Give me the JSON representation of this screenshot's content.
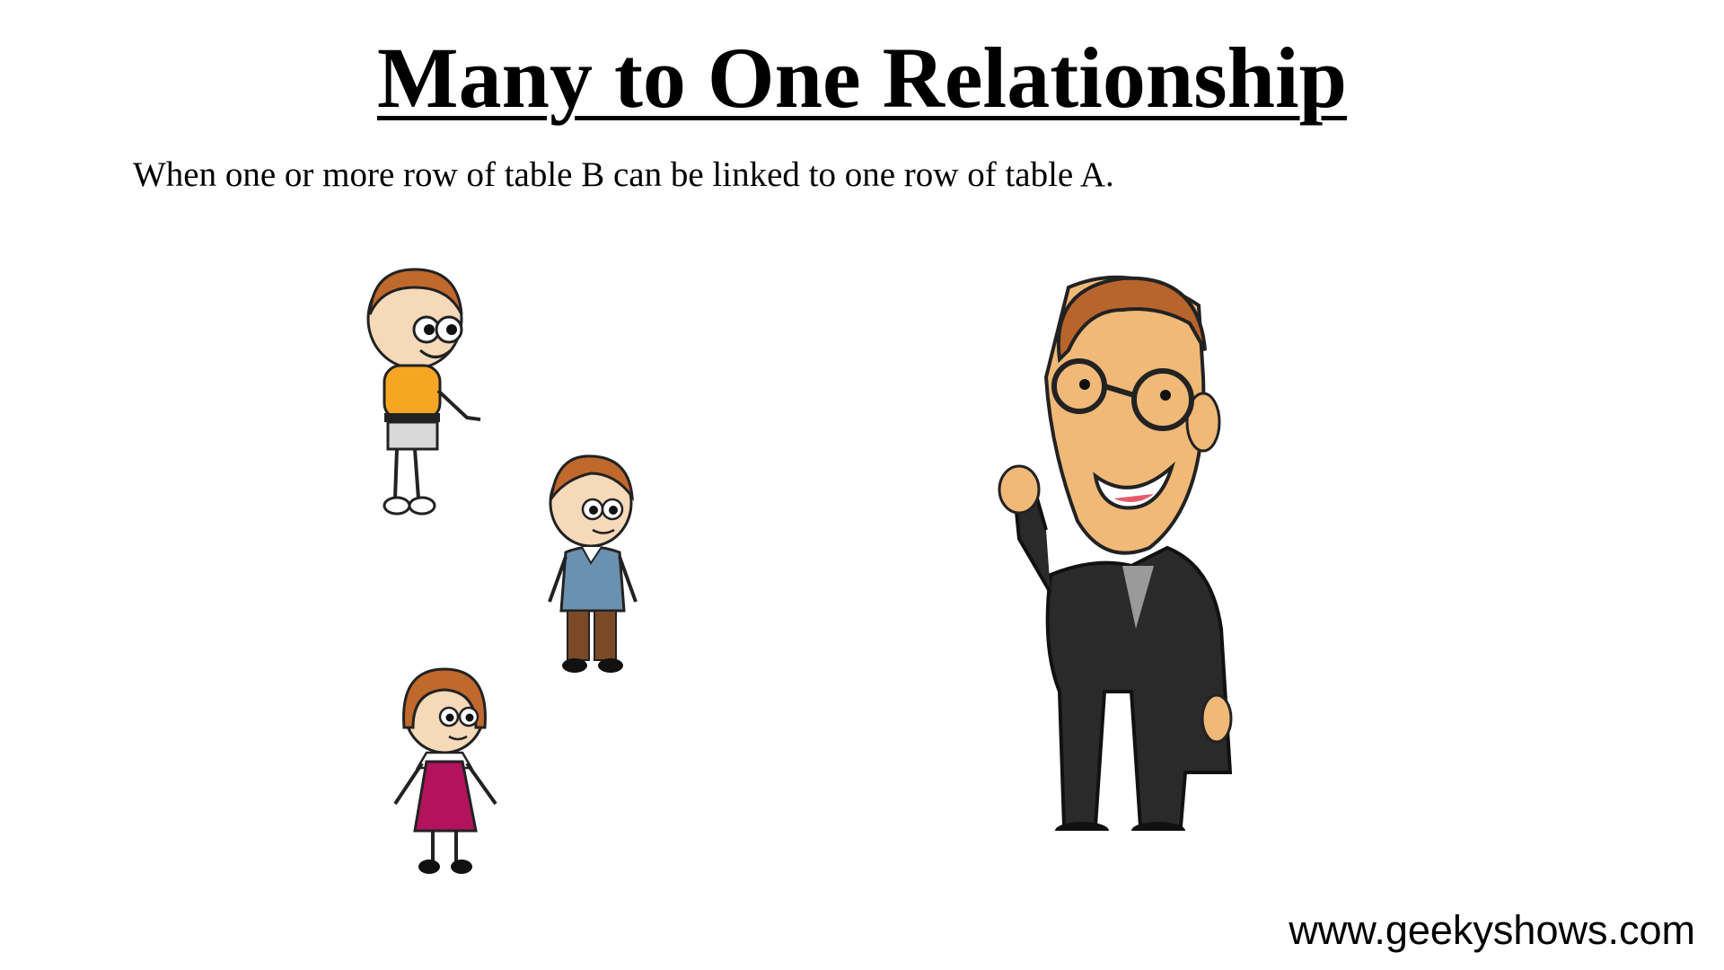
{
  "slide": {
    "title": "Many to One Relationship",
    "description": "When one or more row of table B can be linked to one row of table A.",
    "watermark": "www.geekyshows.com"
  },
  "colors": {
    "skin": "#f6d9b9",
    "hair": "#c0692c",
    "boy_shirt": "#f6a623",
    "boy2_sweater": "#6b91b0",
    "boy2_pants": "#7a4a26",
    "girl_dress": "#b3135c",
    "man_suit": "#2a2a2a",
    "man_skin": "#f0b978"
  }
}
